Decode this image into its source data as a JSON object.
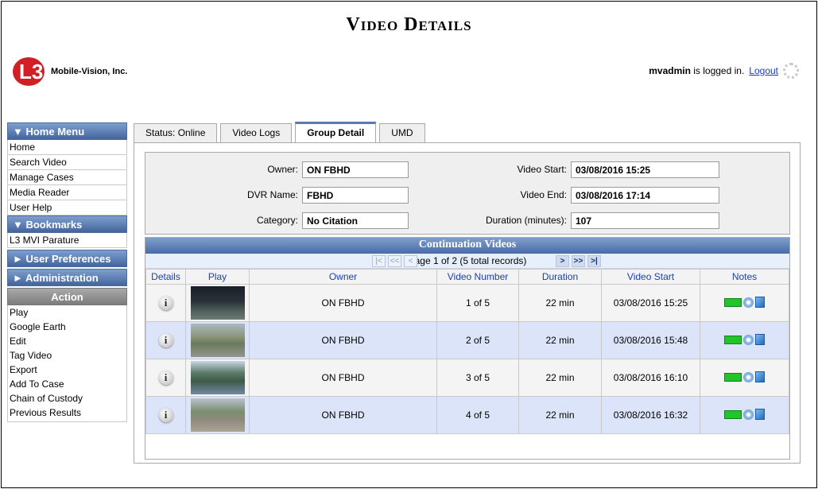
{
  "page": {
    "title": "Video Details"
  },
  "brand": {
    "logo_mark": "L3",
    "company": "Mobile-Vision, Inc."
  },
  "session": {
    "user": "mvadmin",
    "logged_in_text": " is logged in.",
    "logout_label": "Logout"
  },
  "sidebar": {
    "home_menu": {
      "label": "▼ Home Menu",
      "items": [
        "Home",
        "Search Video",
        "Manage Cases",
        "Media Reader",
        "User Help"
      ]
    },
    "bookmarks": {
      "label": "▼ Bookmarks",
      "items": [
        "L3 MVI Parature"
      ]
    },
    "user_preferences": {
      "label": "► User Preferences"
    },
    "administration": {
      "label": "► Administration"
    },
    "action": {
      "label": "Action",
      "items": [
        "Play",
        "Google Earth",
        "Edit",
        "Tag Video",
        "Export",
        "Add To Case",
        "Chain of Custody",
        "Previous Results"
      ]
    }
  },
  "tabs": [
    {
      "label": "Status: Online",
      "active": false
    },
    {
      "label": "Video Logs",
      "active": false
    },
    {
      "label": "Group Detail",
      "active": true
    },
    {
      "label": "UMD",
      "active": false
    }
  ],
  "details": {
    "owner": {
      "label": "Owner:",
      "value": "ON FBHD"
    },
    "dvr_name": {
      "label": "DVR Name:",
      "value": "FBHD"
    },
    "category": {
      "label": "Category:",
      "value": "No Citation"
    },
    "video_start": {
      "label": "Video Start:",
      "value": "03/08/2016 15:25"
    },
    "video_end": {
      "label": "Video End:",
      "value": "03/08/2016 17:14"
    },
    "duration": {
      "label": "Duration (minutes):",
      "value": "107"
    }
  },
  "continuation": {
    "title": "Continuation Videos",
    "pager_text": "Page 1 of 2 (5 total records)",
    "pager_icons": [
      "first-page-icon",
      "prev-page-fast-icon",
      "prev-page-icon",
      "next-page-icon",
      "next-page-fast-icon",
      "last-page-icon"
    ],
    "columns": [
      "Details",
      "Play",
      "Owner",
      "Video Number",
      "Duration",
      "Video Start",
      "Notes"
    ],
    "rows": [
      {
        "owner": "ON FBHD",
        "video_number": "1 of 5",
        "duration": "22 min",
        "video_start": "03/08/2016 15:25"
      },
      {
        "owner": "ON FBHD",
        "video_number": "2 of 5",
        "duration": "22 min",
        "video_start": "03/08/2016 15:48"
      },
      {
        "owner": "ON FBHD",
        "video_number": "3 of 5",
        "duration": "22 min",
        "video_start": "03/08/2016 16:10"
      },
      {
        "owner": "ON FBHD",
        "video_number": "4 of 5",
        "duration": "22 min",
        "video_start": "03/08/2016 16:32"
      }
    ]
  },
  "colors": {
    "header_blue": "#4a6ba4",
    "row_alt": "#dbe4f8",
    "link": "#1a3fb8",
    "brand_red": "#d21f26"
  }
}
